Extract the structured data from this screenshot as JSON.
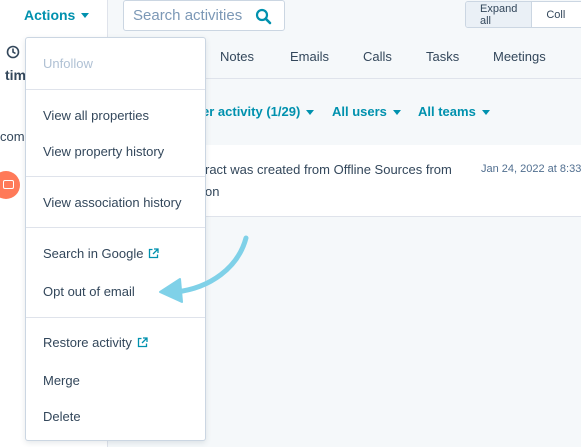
{
  "header": {
    "actions_label": "Actions",
    "search_placeholder": "Search activities",
    "expand_all": "Expand all",
    "collapse_all": "Coll"
  },
  "left": {
    "partial_title": "tim",
    "partial_text": "com"
  },
  "tabs": [
    "Notes",
    "Emails",
    "Calls",
    "Tasks",
    "Meetings"
  ],
  "filters": {
    "activity": "er activity (1/29)",
    "users": "All users",
    "teams": "All teams"
  },
  "activity": {
    "line1": "ract was created from Offline Sources from",
    "line2": "on",
    "date": "Jan 24, 2022 at 8:33"
  },
  "menu": {
    "unfollow": "Unfollow",
    "view_all_properties": "View all properties",
    "view_property_history": "View property history",
    "view_association_history": "View association history",
    "search_in_google": "Search in Google",
    "opt_out_of_email": "Opt out of email",
    "restore_activity": "Restore activity",
    "merge": "Merge",
    "delete": "Delete"
  },
  "colors": {
    "link": "#0091ae",
    "text": "#33475b",
    "muted": "#b0c1d4",
    "arrow": "#7fd1e8",
    "avatar": "#ff7a59"
  }
}
